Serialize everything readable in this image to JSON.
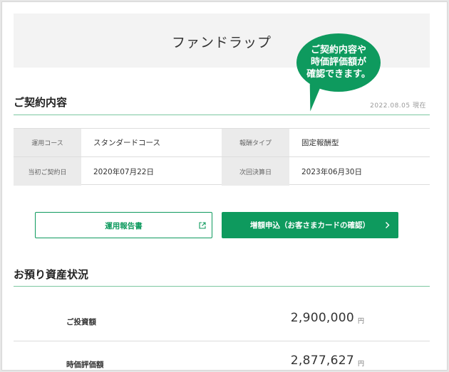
{
  "header": {
    "title": "ファンドラップ",
    "callout": [
      "ご契約内容や",
      "時価評価額が",
      "確認できます。"
    ]
  },
  "contract": {
    "section_title": "ご契約内容",
    "as_of": "2022.08.05 現在",
    "rows": [
      [
        {
          "label": "運用コース",
          "value": "スタンダードコース"
        },
        {
          "label": "報酬タイプ",
          "value": "固定報酬型"
        }
      ],
      [
        {
          "label": "当初ご契約日",
          "value": "2020年07月22日"
        },
        {
          "label": "次回決算日",
          "value": "2023年06月30日"
        }
      ]
    ]
  },
  "buttons": {
    "report_label": "運用報告書",
    "apply_label": "増額申込（お客さまカードの確認）"
  },
  "assets": {
    "section_title": "お預り資産状況",
    "items": [
      {
        "label": "ご投資額",
        "amount": "2,900,000",
        "unit": "円"
      },
      {
        "label": "時価評価額",
        "amount": "2,877,627",
        "unit": "円"
      }
    ]
  },
  "colors": {
    "accent": "#0e9a5e",
    "rule": "#7cc7a1",
    "label_bg": "#ebebeb"
  },
  "icons": [
    "external-link-icon",
    "chevron-right-icon"
  ]
}
